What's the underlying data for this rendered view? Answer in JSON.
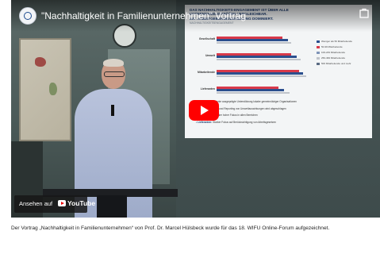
{
  "video": {
    "title": "\"Nachhaltigkeit in Familienunternehmen\" Vortrag",
    "channel_icon": "channel-logo-icon",
    "share_label": "Teilen",
    "watch_on_label": "Ansehen auf",
    "youtube_label": "YouTube",
    "play_icon": "play-icon",
    "accent_color": "#ff0000"
  },
  "slide": {
    "title_line1": "DAS NACHHALTIGKEITS-ENGAGEMENT IST ÜBER ALLE",
    "title_line2": "UNTERNEHMENSGRÖßEN VERGLEICHBAR.",
    "title_line3": "MIT ARBEITGEBERORIENTIERUNG DOMINIERT.",
    "subtitle": "NACHHALTIGKEITSENGAGEMENT",
    "rows": [
      {
        "label": "Gesellschaft",
        "values": [
          0.7,
          0.76,
          0.8
        ]
      },
      {
        "label": "Umwelt",
        "values": [
          0.8,
          0.86,
          0.9
        ]
      },
      {
        "label": "Mitarbeitende",
        "values": [
          0.88,
          0.92,
          0.96
        ]
      },
      {
        "label": "Lieferanten",
        "values": [
          0.66,
          0.72,
          0.78
        ]
      }
    ],
    "series_colors": [
      "#d8394a",
      "#2b4f8e",
      "#c0c4ca"
    ],
    "legend": [
      {
        "label": "Weniger als 50 Mitarbeitende",
        "color": "#2b4f8e"
      },
      {
        "label": "50-99 Mitarbeitende",
        "color": "#d8394a"
      },
      {
        "label": "100-249 Mitarbeitende",
        "color": "#7f94b8"
      },
      {
        "label": "250-499 Mitarbeitende",
        "color": "#c0c4ca"
      },
      {
        "label": "500 Mitarbeitende und mehr",
        "color": "#5a6b83"
      }
    ],
    "bullets": [
      {
        "head": "Gesellschaft:",
        "text": "Starke ausgeprägte Unterstützung lokaler gemeinnütziger Organisationen"
      },
      {
        "head": "Umwelt:",
        "text": "Messung und Reporting von Umweltauswirkungen wird abgeschlagen"
      },
      {
        "head": "Mitarbeiter:",
        "text": "Zentraler hoher Fokus in allen Bereichen"
      },
      {
        "head": "Lieferanten:",
        "text": "Starker Fokus auf Berücksichtigung von Arbeitsgesetzen"
      }
    ]
  },
  "caption": "Der Vortrag „Nachhaltigkeit in Familienunternehmen“ von Prof. Dr. Marcel Hülsbeck wurde für das 18. WIFU Online-Forum aufgezeichnet."
}
